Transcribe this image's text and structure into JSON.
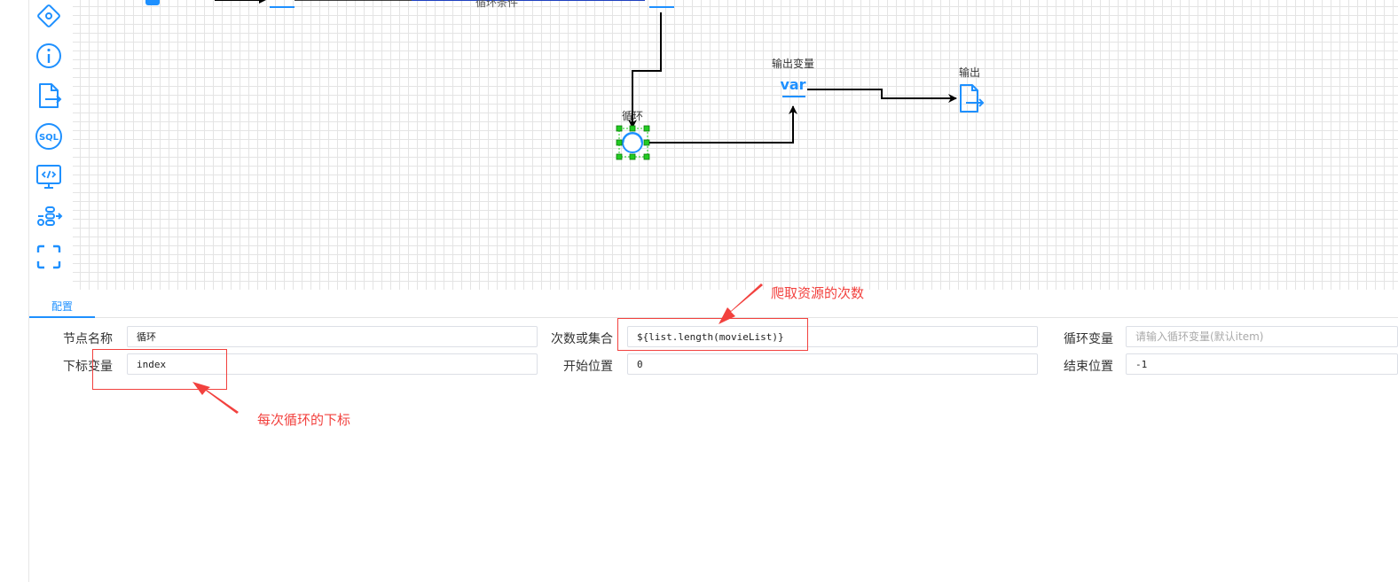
{
  "canvas": {
    "nodes": {
      "loop_condition_label": "循环条件",
      "loop_label": "循环",
      "output_var_label": "输出变量",
      "output_var_text": "var",
      "output_label": "输出"
    }
  },
  "config": {
    "tab_label": "配置",
    "fields": {
      "node_name_label": "节点名称",
      "node_name_value": "循环",
      "count_label": "次数或集合",
      "count_value": "${list.length(movieList)}",
      "loop_var_label": "循环变量",
      "loop_var_placeholder": "请输入循环变量(默认item)",
      "index_label": "下标变量",
      "index_value": "index",
      "start_label": "开始位置",
      "start_value": "0",
      "end_label": "结束位置",
      "end_value": "-1"
    }
  },
  "annotations": {
    "count_note": "爬取资源的次数",
    "index_note": "每次循环的下标"
  },
  "colors": {
    "accent": "#1e90ff",
    "annotation": "#f2413e",
    "selection": "#22cc22"
  }
}
